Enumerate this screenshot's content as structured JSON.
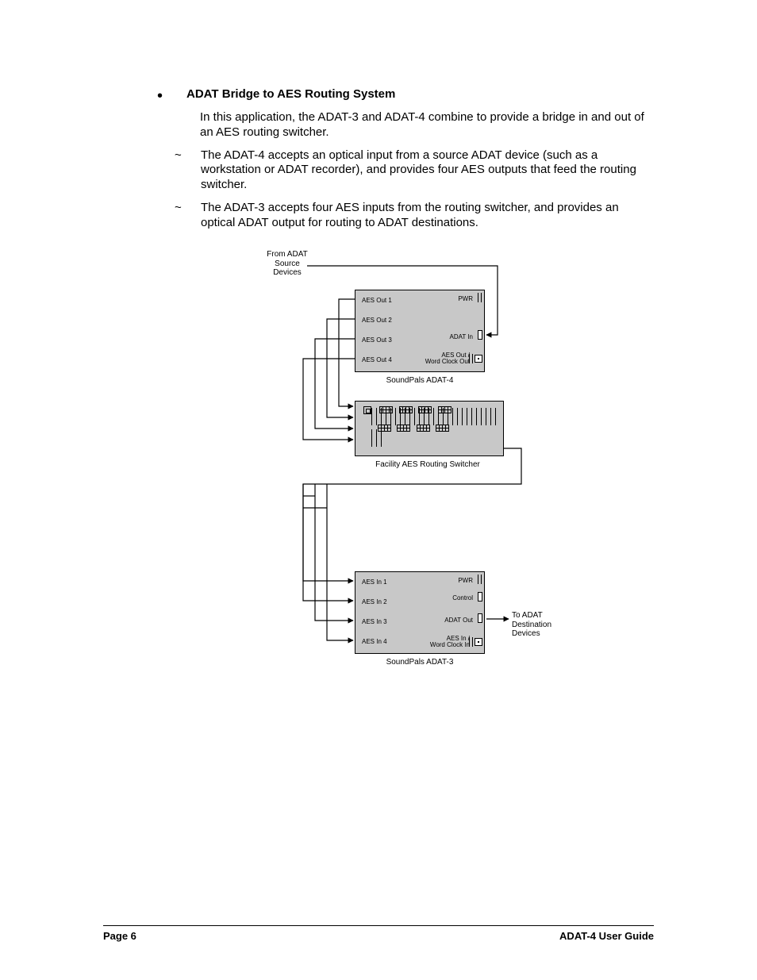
{
  "heading": "ADAT Bridge to AES Routing System",
  "intro": "In this application, the ADAT-3 and ADAT-4 combine to provide a bridge in and out of an AES routing switcher.",
  "bullets": [
    "The ADAT-4 accepts an optical input from a source ADAT device (such as a workstation or ADAT recorder), and provides four AES outputs that feed the routing switcher.",
    "The ADAT-3 accepts four AES inputs from the routing switcher, and provides an optical ADAT output for routing to ADAT destinations."
  ],
  "diagram": {
    "source_label": "From ADAT\nSource\nDevices",
    "dest_label": "To ADAT\nDestination\nDevices",
    "adat4": {
      "caption": "SoundPals ADAT-4",
      "left_ports": [
        "AES Out 1",
        "AES Out 2",
        "AES Out 3",
        "AES Out 4"
      ],
      "right_ports": [
        "PWR",
        "ADAT In",
        "AES Out /\nWord Clock Out"
      ]
    },
    "switcher": {
      "caption": "Facility AES Routing Switcher"
    },
    "adat3": {
      "caption": "SoundPals ADAT-3",
      "left_ports": [
        "AES In 1",
        "AES In 2",
        "AES In 3",
        "AES In 4"
      ],
      "right_ports": [
        "PWR",
        "Control",
        "ADAT Out",
        "AES In /\nWord Clock In"
      ]
    }
  },
  "footer": {
    "page": "Page 6",
    "title": "ADAT-4 User Guide"
  }
}
